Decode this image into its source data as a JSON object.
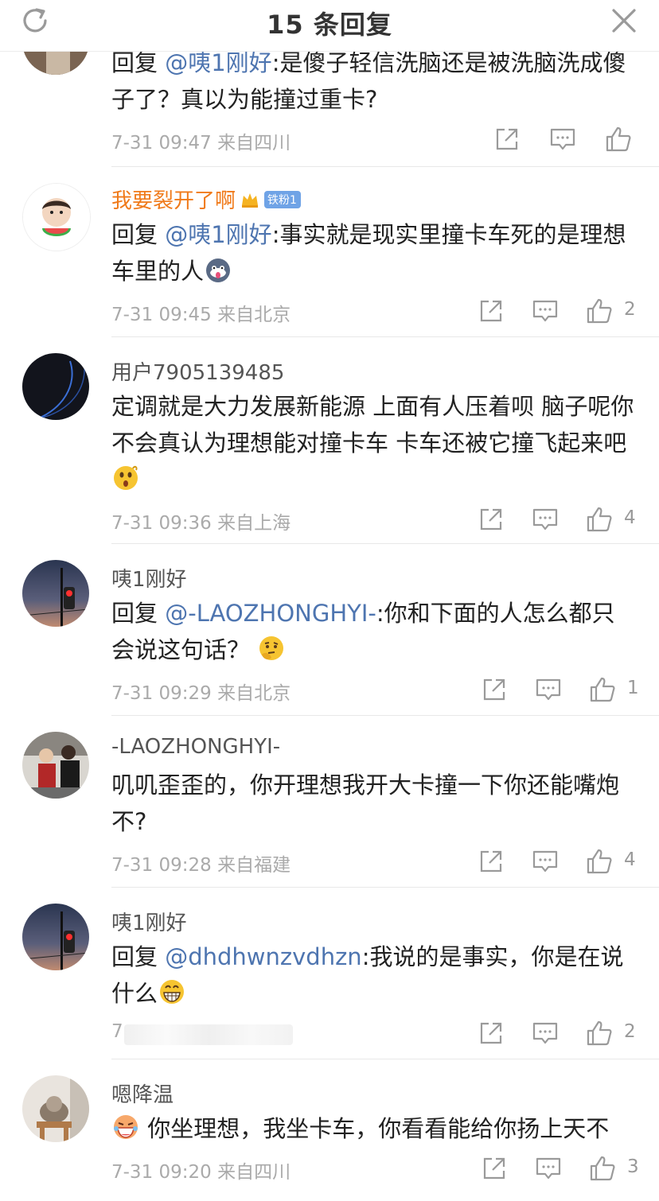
{
  "header": {
    "title": "15 条回复"
  },
  "comments": [
    {
      "username": "",
      "reply_prefix": "回复",
      "mention": "@咦1刚好",
      "text": ":是傻子轻信洗脑还是被洗脑洗成傻子了？真以为能撞过重卡?",
      "time": "7-31 09:47",
      "location": "来自四川",
      "likes": ""
    },
    {
      "username": "我要裂开了啊",
      "badge": "铁粉1",
      "reply_prefix": "回复",
      "mention": "@咦1刚好",
      "text": ":事实就是现实里撞卡车死的是理想车里的人",
      "emoji": "husky-emoji",
      "time": "7-31 09:45",
      "location": "来自北京",
      "likes": "2"
    },
    {
      "username": "用户7905139485",
      "text": "定调就是大力发展新能源 上面有人压着呗 脑子呢你不会真认为理想能对撞卡车 卡车还被它撞飞起来吧",
      "emoji": "surprised-emoji",
      "time": "7-31 09:36",
      "location": "来自上海",
      "likes": "4"
    },
    {
      "username": "咦1刚好",
      "reply_prefix": "回复",
      "mention": "@-LAOZHONGHYI-",
      "text": ":你和下面的人怎么都只会说这句话？",
      "emoji": "thinking-emoji",
      "time": "7-31 09:29",
      "location": "来自北京",
      "likes": "1"
    },
    {
      "username": "-LAOZHONGHYI-",
      "text": "叽叽歪歪的，你开理想我开大卡撞一下你还能嘴炮不?",
      "time": "7-31 09:28",
      "location": "来自福建",
      "likes": "4"
    },
    {
      "username": "咦1刚好",
      "reply_prefix": "回复",
      "mention": "@dhdhwnzvdhzn",
      "text": ":我说的是事实，你是在说什么",
      "emoji": "grin-emoji",
      "time": "7",
      "location": "",
      "likes": "2"
    },
    {
      "username": "嗯降温",
      "text": "你坐理想，我坐卡车，你看看能给你扬上天不",
      "emoji": "laugh-emoji",
      "time": "7-31 09:20",
      "location": "来自四川",
      "likes": "3"
    }
  ],
  "colors": {
    "mention": "#4e75b0",
    "vip_name": "#f07a1a",
    "meta": "#aaaaaa",
    "icon": "#9a9a9a"
  }
}
